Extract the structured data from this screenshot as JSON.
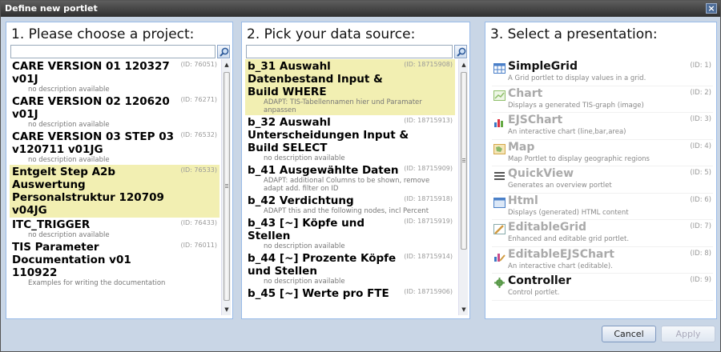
{
  "window": {
    "title": "Define new portlet",
    "close_glyph": "×"
  },
  "projects": {
    "header": "1. Please choose a project:",
    "search": {
      "value": "",
      "placeholder": ""
    },
    "items": [
      {
        "title": "CARE VERSION 01 120327 v01J",
        "id": "(ID: 76051)",
        "desc": "no description available",
        "selected": false
      },
      {
        "title": "CARE VERSION 02 120620 v01J",
        "id": "(ID: 76271)",
        "desc": "no description available",
        "selected": false
      },
      {
        "title": "CARE VERSION 03 STEP 03 v120711 v01JG",
        "id": "(ID: 76532)",
        "desc": "no description available",
        "selected": false
      },
      {
        "title": "Entgelt Step A2b Auswertung Personalstruktur 120709 v04JG",
        "id": "(ID: 76533)",
        "desc": "",
        "selected": true
      },
      {
        "title": "ITC_TRIGGER",
        "id": "(ID: 76433)",
        "desc": "no description available",
        "selected": false
      },
      {
        "title": "TIS Parameter Documentation v01 110922",
        "id": "(ID: 76011)",
        "desc": "Examples for writing the documentation",
        "selected": false
      }
    ]
  },
  "datasources": {
    "header": "2. Pick your data source:",
    "search": {
      "value": "",
      "placeholder": ""
    },
    "items": [
      {
        "title": "b_31 Auswahl Datenbestand Input & Build WHERE",
        "id": "(ID: 18715908)",
        "desc": "ADAPT: TIS-Tabellennamen hier und Paramater anpassen",
        "selected": true
      },
      {
        "title": "b_32 Auswahl Unterscheidungen Input & Build SELECT",
        "id": "(ID: 18715913)",
        "desc": "no description available",
        "selected": false
      },
      {
        "title": "b_41 Ausgewählte Daten",
        "id": "(ID: 18715909)",
        "desc": "ADAPT: additional Columns to be shown, remove adapt add. filter on ID",
        "selected": false
      },
      {
        "title": "b_42 Verdichtung",
        "id": "(ID: 18715918)",
        "desc": "ADAPT this and the following nodes, incl Percent",
        "selected": false
      },
      {
        "title": "b_43 [~] Köpfe und Stellen",
        "id": "(ID: 18715919)",
        "desc": "no description available",
        "selected": false
      },
      {
        "title": "b_44 [~] Prozente Köpfe und Stellen",
        "id": "(ID: 18715914)",
        "desc": "no description available",
        "selected": false
      },
      {
        "title": "b_45 [~] Werte pro FTE",
        "id": "(ID: 18715906)",
        "desc": "",
        "selected": false
      }
    ]
  },
  "presentations": {
    "header": "3. Select a presentation:",
    "items": [
      {
        "title": "SimpleGrid",
        "id": "(ID: 1)",
        "desc": "A Grid portlet to display values in a grid.",
        "active": true,
        "icon": "grid-icon",
        "color": "#4a7fc8"
      },
      {
        "title": "Chart",
        "id": "(ID: 2)",
        "desc": "Displays a generated TIS-graph (image)",
        "active": false,
        "icon": "chart-icon",
        "color": "#8fbf6a"
      },
      {
        "title": "EJSChart",
        "id": "(ID: 3)",
        "desc": "An interactive chart (line,bar,area)",
        "active": false,
        "icon": "bar-chart-icon",
        "color": "#3b78c5"
      },
      {
        "title": "Map",
        "id": "(ID: 4)",
        "desc": "Map Portlet to display geographic regions",
        "active": false,
        "icon": "map-icon",
        "color": "#d4a84a"
      },
      {
        "title": "QuickView",
        "id": "(ID: 5)",
        "desc": "Generates an overview portlet",
        "active": false,
        "icon": "list-icon",
        "color": "#555555"
      },
      {
        "title": "Html",
        "id": "(ID: 6)",
        "desc": "Displays (generated) HTML content",
        "active": false,
        "icon": "html-icon",
        "color": "#4a80c8"
      },
      {
        "title": "EditableGrid",
        "id": "(ID: 7)",
        "desc": "Enhanced and editable grid portlet.",
        "active": false,
        "icon": "edit-grid-icon",
        "color": "#d09a40"
      },
      {
        "title": "EditableEJSChart",
        "id": "(ID: 8)",
        "desc": "An interactive chart (editable).",
        "active": false,
        "icon": "edit-chart-icon",
        "color": "#c84a8a"
      },
      {
        "title": "Controller",
        "id": "(ID: 9)",
        "desc": "Control portlet.",
        "active": true,
        "icon": "gear-icon",
        "color": "#5a9a4a"
      }
    ]
  },
  "buttons": {
    "cancel": "Cancel",
    "apply": "Apply"
  }
}
